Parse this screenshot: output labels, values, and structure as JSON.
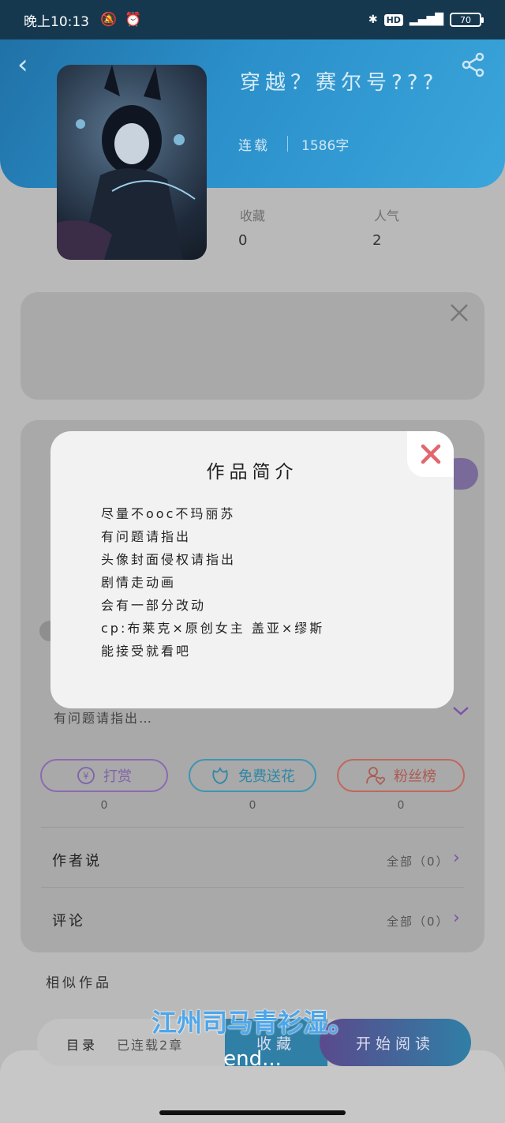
{
  "status_bar": {
    "time": "晚上10:13",
    "battery": "70"
  },
  "book": {
    "title": "穿越？赛尔号???",
    "status": "连载",
    "word_count": "1586字",
    "stats": [
      {
        "label": "收藏",
        "value": "0"
      },
      {
        "label": "人气",
        "value": "2"
      }
    ]
  },
  "intro_preview": "有问题请指出…",
  "actions": [
    {
      "label": "打赏",
      "count": "0"
    },
    {
      "label": "免费送花",
      "count": "0"
    },
    {
      "label": "粉丝榜",
      "count": "0"
    }
  ],
  "rows": [
    {
      "label": "作者说",
      "link": "全部（0）"
    },
    {
      "label": "评论",
      "link": "全部（0）"
    }
  ],
  "similar_title": "相似作品",
  "bottom": {
    "catalog": "目录",
    "chapters": "已连载2章",
    "collect": "收藏",
    "read": "开始阅读"
  },
  "subtitles": {
    "cn": "江州司马青衫湿。",
    "en": "end..."
  },
  "modal": {
    "title": "作品简介",
    "lines": [
      "尽量不ooc不玛丽苏",
      "有问题请指出",
      "头像封面侵权请指出",
      "剧情走动画",
      "会有一部分改动",
      "cp:布莱克×原创女主  盖亚×缪斯",
      "能接受就看吧"
    ]
  },
  "colors": {
    "header_accent": "#2b8fca",
    "reward": "#8b6bb3",
    "flower": "#3e95b2",
    "fans": "#c0675c",
    "close_red": "#e2676f"
  }
}
